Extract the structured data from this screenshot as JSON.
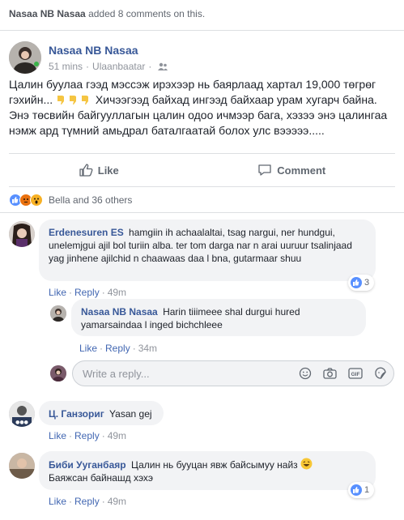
{
  "topbar": {
    "author": "Nasaa NB Nasaa",
    "activity": " added 8 comments on this."
  },
  "post": {
    "author": "Nasaa NB Nasaa",
    "time": "51 mins",
    "location": "Ulaanbaatar",
    "text_part1": "Цалин буулаа гээд мэссэж ирэхээр нь баярлаад хартал 19,000 төгрөг гэхийн...",
    "text_part2": " Хичээгээд байхад ингээд байхаар урам хугарч байна. Энэ төсвийн байгууллагын цалин одоо ичмээр бага, хэзээ энэ цалингаа нэмж ард түмний амьдрал баталгаатай болох улс вэээээ.....",
    "emoji_icons": [
      "thumbs-down-emoji",
      "thumbs-down-emoji",
      "thumbs-down-emoji"
    ]
  },
  "actions": {
    "like_label": "Like",
    "comment_label": "Comment"
  },
  "reactions": {
    "summary": "Bella and 36 others",
    "icons": [
      "like-reaction-icon",
      "angry-reaction-icon",
      "wow-reaction-icon"
    ]
  },
  "comments": [
    {
      "author": "Erdenesuren ES",
      "text": "hamgiin ih achaalaltai, tsag nargui, ner hundgui, unelemjgui ajil bol turiin alba. ter tom darga nar n arai uuruur tsalinjaad yag jinhene ajilchid n chaawaas daa l bna, gutarmaar shuu",
      "like_label": "Like",
      "reply_label": "Reply",
      "time": "49m",
      "likes": "3"
    },
    {
      "author": "Nasaa NB Nasaa",
      "text": "Harin tiiimeee shal durgui hured yamarsaindaa l inged bichchleee",
      "like_label": "Like",
      "reply_label": "Reply",
      "time": "34m"
    },
    {
      "author": "Ц. Ганзориг",
      "text": "Yasan gej",
      "like_label": "Like",
      "reply_label": "Reply",
      "time": "49m"
    },
    {
      "author": "Биби Ууганбаяр",
      "text": "Цалин нь бууцан явж байсымуу найз",
      "text2": "Баяжсан байнашд хэхэ",
      "like_label": "Like",
      "reply_label": "Reply",
      "time": "49m",
      "likes": "1"
    }
  ],
  "reply_box": {
    "placeholder": "Write a reply...",
    "icons": [
      "emoji-icon",
      "camera-icon",
      "gif-icon",
      "sticker-icon"
    ]
  },
  "colors": {
    "link": "#385898",
    "action_link": "#4267b2",
    "bubble_bg": "#f2f3f5",
    "like_blue": "#5890ff"
  }
}
